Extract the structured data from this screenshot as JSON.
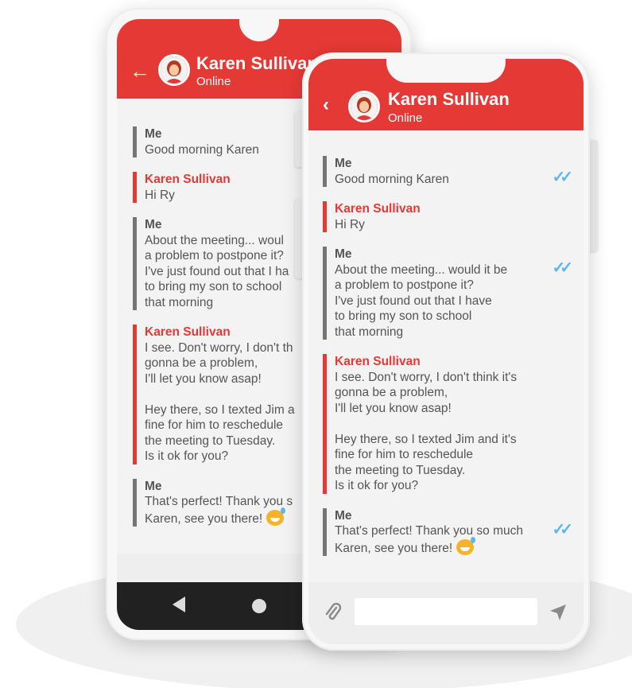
{
  "contact": {
    "name": "Karen Sullivan",
    "status": "Online"
  },
  "icons": {
    "back": "back-arrow-icon",
    "avatar": "avatar-icon",
    "read": "double-check-icon",
    "attach": "paperclip-icon",
    "send": "send-icon",
    "nav_back": "nav-back-icon",
    "nav_home": "nav-home-icon"
  },
  "colors": {
    "accent": "#e53935",
    "check": "#5cb7ea",
    "own_bar": "#757575"
  },
  "back_phone": {
    "messages": [
      {
        "sender": "Me",
        "text": "Good morning Karen"
      },
      {
        "sender": "Karen Sullivan",
        "text": "Hi Ry"
      },
      {
        "sender": "Me",
        "text": "About the meeting... woul\na problem to postpone it?\nI've just found out that I ha\nto bring my son to school\nthat morning"
      },
      {
        "sender": "Karen Sullivan",
        "text": "I see. Don't worry, I don't th\ngonna be a problem,\nI'll let you know asap!\n\nHey there, so I texted Jim a\nfine for him to reschedule\nthe meeting to Tuesday.\nIs it ok for you?"
      },
      {
        "sender": "Me",
        "text": "That's perfect! Thank you s\nKaren, see you there!"
      }
    ]
  },
  "front_phone": {
    "messages": [
      {
        "sender": "Me",
        "text": "Good morning Karen"
      },
      {
        "sender": "Karen Sullivan",
        "text": "Hi Ry"
      },
      {
        "sender": "Me",
        "text": "About the meeting... would it be\na problem to postpone it?\nI've just found out that I have\nto bring my son to school\nthat morning"
      },
      {
        "sender": "Karen Sullivan",
        "text": "I see. Don't worry, I don't think it's\ngonna be a problem,\nI'll let you know asap!\n\nHey there, so I texted Jim and it's\nfine for him to reschedule\nthe meeting to Tuesday.\nIs it ok for you?"
      },
      {
        "sender": "Me",
        "text": "That's perfect! Thank you so much\nKaren, see you there!"
      }
    ],
    "input_placeholder": ""
  }
}
